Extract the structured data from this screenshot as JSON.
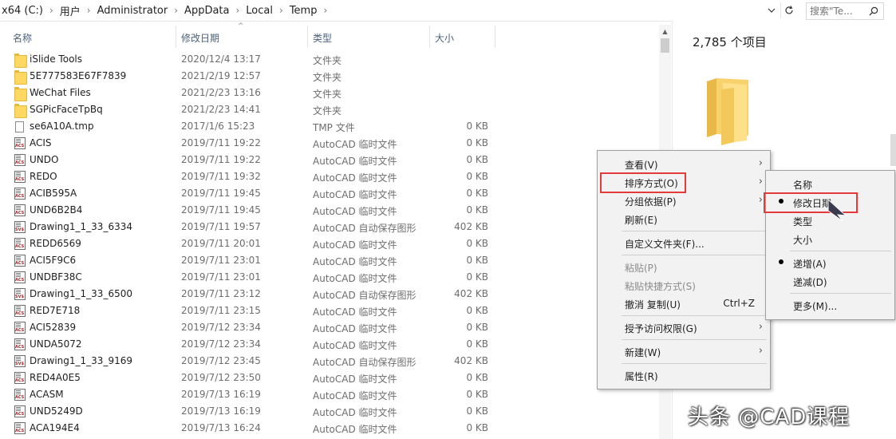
{
  "address": {
    "breadcrumbs": [
      "x64 (C:)",
      "用户",
      "Administrator",
      "AppData",
      "Local",
      "Temp"
    ],
    "dropdown_icon": "chevron-down-icon",
    "refresh_icon": "refresh-icon"
  },
  "search": {
    "placeholder": "搜索\"Te..."
  },
  "columns": {
    "name": "名称",
    "date": "修改日期",
    "type": "类型",
    "size": "大小"
  },
  "files": [
    {
      "name": "iSlide Tools",
      "date": "2020/12/4 13:17",
      "type": "文件夹",
      "size": "",
      "icon": "folder"
    },
    {
      "name": "5E777583E67F7839",
      "date": "2021/2/19 12:57",
      "type": "文件夹",
      "size": "",
      "icon": "folder"
    },
    {
      "name": "WeChat Files",
      "date": "2021/2/23 13:16",
      "type": "文件夹",
      "size": "",
      "icon": "folder"
    },
    {
      "name": "SGPicFaceTpBq",
      "date": "2021/2/23 14:41",
      "type": "文件夹",
      "size": "",
      "icon": "folder"
    },
    {
      "name": "se6A10A.tmp",
      "date": "2017/1/6 15:23",
      "type": "TMP 文件",
      "size": "0 KB",
      "icon": "file"
    },
    {
      "name": "ACIS",
      "date": "2019/7/11 19:22",
      "type": "AutoCAD 临时文件",
      "size": "0 KB",
      "icon": "acs"
    },
    {
      "name": "UNDO",
      "date": "2019/7/11 19:22",
      "type": "AutoCAD 临时文件",
      "size": "0 KB",
      "icon": "acs"
    },
    {
      "name": "REDO",
      "date": "2019/7/11 19:32",
      "type": "AutoCAD 临时文件",
      "size": "0 KB",
      "icon": "acs"
    },
    {
      "name": "ACIB595A",
      "date": "2019/7/11 19:45",
      "type": "AutoCAD 临时文件",
      "size": "0 KB",
      "icon": "acs"
    },
    {
      "name": "UND6B2B4",
      "date": "2019/7/11 19:45",
      "type": "AutoCAD 临时文件",
      "size": "0 KB",
      "icon": "acs"
    },
    {
      "name": "Drawing1_1_33_6334",
      "date": "2019/7/11 19:57",
      "type": "AutoCAD 自动保存图形",
      "size": "402 KB",
      "icon": "sv"
    },
    {
      "name": "REDD6569",
      "date": "2019/7/11 20:01",
      "type": "AutoCAD 临时文件",
      "size": "0 KB",
      "icon": "acs"
    },
    {
      "name": "ACI5F9C6",
      "date": "2019/7/11 23:01",
      "type": "AutoCAD 临时文件",
      "size": "0 KB",
      "icon": "acs"
    },
    {
      "name": "UNDBF38C",
      "date": "2019/7/11 23:01",
      "type": "AutoCAD 临时文件",
      "size": "0 KB",
      "icon": "acs"
    },
    {
      "name": "Drawing1_1_33_6500",
      "date": "2019/7/11 23:12",
      "type": "AutoCAD 自动保存图形",
      "size": "402 KB",
      "icon": "sv"
    },
    {
      "name": "RED7E718",
      "date": "2019/7/11 23:15",
      "type": "AutoCAD 临时文件",
      "size": "0 KB",
      "icon": "acs"
    },
    {
      "name": "ACI52839",
      "date": "2019/7/12 23:34",
      "type": "AutoCAD 临时文件",
      "size": "0 KB",
      "icon": "acs"
    },
    {
      "name": "UNDA5072",
      "date": "2019/7/12 23:34",
      "type": "AutoCAD 临时文件",
      "size": "0 KB",
      "icon": "acs"
    },
    {
      "name": "Drawing1_1_33_9169",
      "date": "2019/7/12 23:45",
      "type": "AutoCAD 自动保存图形",
      "size": "402 KB",
      "icon": "sv"
    },
    {
      "name": "RED4A0E5",
      "date": "2019/7/12 23:50",
      "type": "AutoCAD 临时文件",
      "size": "0 KB",
      "icon": "acs"
    },
    {
      "name": "ACASM",
      "date": "2019/7/13 16:19",
      "type": "AutoCAD 临时文件",
      "size": "0 KB",
      "icon": "acs"
    },
    {
      "name": "UND5249D",
      "date": "2019/7/13 16:19",
      "type": "AutoCAD 临时文件",
      "size": "0 KB",
      "icon": "acs"
    },
    {
      "name": "ACA194E4",
      "date": "2019/7/13 16:24",
      "type": "AutoCAD 临时文件",
      "size": "0 KB",
      "icon": "acs"
    }
  ],
  "preview": {
    "item_count": "2,785 个项目"
  },
  "context_menu": {
    "view": "查看(V)",
    "sort_by": "排序方式(O)",
    "group_by": "分组依据(P)",
    "refresh": "刷新(E)",
    "customize": "自定义文件夹(F)...",
    "paste": "粘贴(P)",
    "paste_shortcut": "粘贴快捷方式(S)",
    "undo_copy": "撤消 复制(U)",
    "undo_shortcut": "Ctrl+Z",
    "give_access": "授予访问权限(G)",
    "new": "新建(W)",
    "properties": "属性(R)"
  },
  "sort_menu": {
    "name": "名称",
    "date_modified": "修改日期",
    "type": "类型",
    "size": "大小",
    "ascending": "递增(A)",
    "descending": "递减(D)",
    "more": "更多(M)..."
  },
  "watermark": "头条 @CAD课程",
  "colors": {
    "highlight_box": "#e53a3a",
    "folder": "#ffd863",
    "menu_bg": "#f2f2f2",
    "header_text": "#4c607a"
  }
}
